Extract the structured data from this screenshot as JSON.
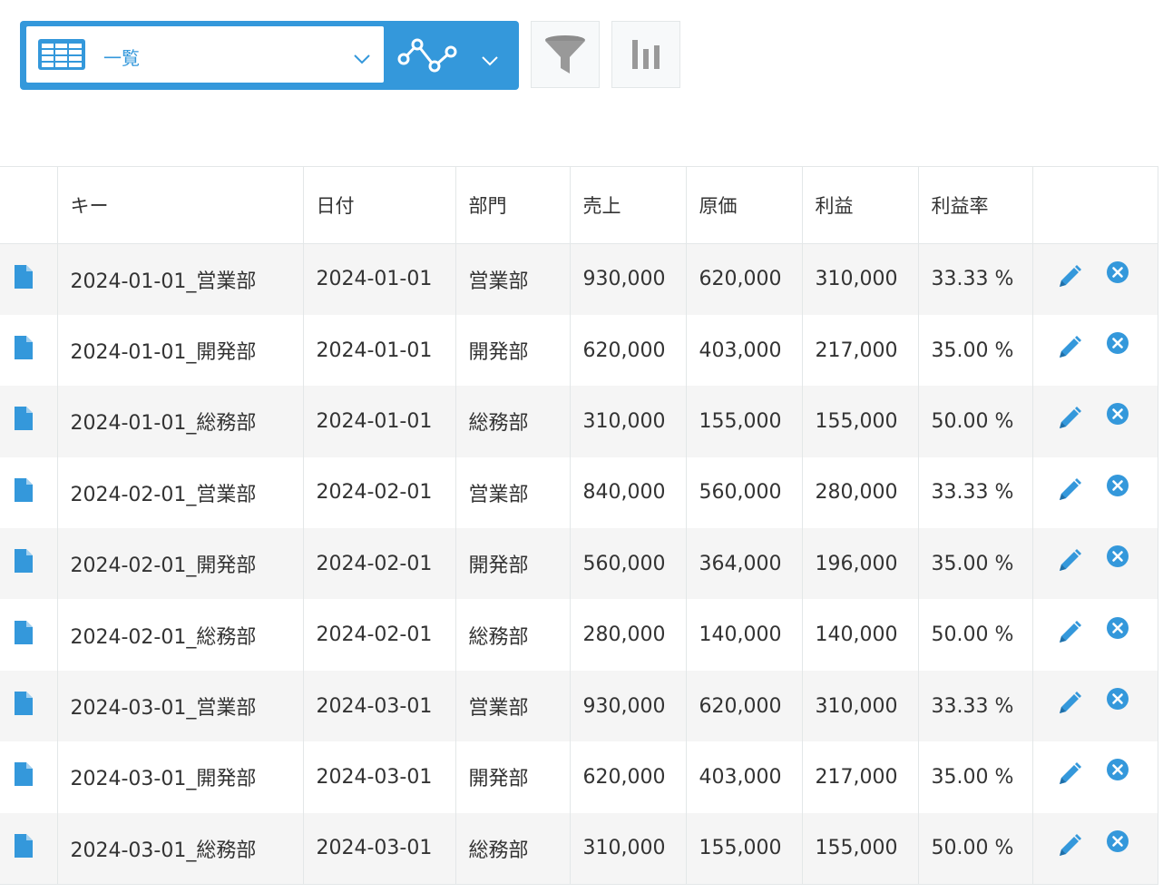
{
  "toolbar": {
    "view_label": "一覧",
    "icons": {
      "view": "table-list-icon",
      "graph": "line-graph-icon",
      "filter": "filter-funnel-icon",
      "report": "bar-chart-icon"
    }
  },
  "colors": {
    "accent": "#3498db",
    "row_alt": "#f5f5f5",
    "border": "#e3e7e8"
  },
  "table": {
    "headers": [
      "キー",
      "日付",
      "部門",
      "売上",
      "原価",
      "利益",
      "利益率"
    ],
    "rows": [
      {
        "key": "2024-01-01_営業部",
        "date": "2024-01-01",
        "dept": "営業部",
        "sales": "930,000",
        "cost": "620,000",
        "profit": "310,000",
        "rate": "33.33 %"
      },
      {
        "key": "2024-01-01_開発部",
        "date": "2024-01-01",
        "dept": "開発部",
        "sales": "620,000",
        "cost": "403,000",
        "profit": "217,000",
        "rate": "35.00 %"
      },
      {
        "key": "2024-01-01_総務部",
        "date": "2024-01-01",
        "dept": "総務部",
        "sales": "310,000",
        "cost": "155,000",
        "profit": "155,000",
        "rate": "50.00 %"
      },
      {
        "key": "2024-02-01_営業部",
        "date": "2024-02-01",
        "dept": "営業部",
        "sales": "840,000",
        "cost": "560,000",
        "profit": "280,000",
        "rate": "33.33 %"
      },
      {
        "key": "2024-02-01_開発部",
        "date": "2024-02-01",
        "dept": "開発部",
        "sales": "560,000",
        "cost": "364,000",
        "profit": "196,000",
        "rate": "35.00 %"
      },
      {
        "key": "2024-02-01_総務部",
        "date": "2024-02-01",
        "dept": "総務部",
        "sales": "280,000",
        "cost": "140,000",
        "profit": "140,000",
        "rate": "50.00 %"
      },
      {
        "key": "2024-03-01_営業部",
        "date": "2024-03-01",
        "dept": "営業部",
        "sales": "930,000",
        "cost": "620,000",
        "profit": "310,000",
        "rate": "33.33 %"
      },
      {
        "key": "2024-03-01_開発部",
        "date": "2024-03-01",
        "dept": "開発部",
        "sales": "620,000",
        "cost": "403,000",
        "profit": "217,000",
        "rate": "35.00 %"
      },
      {
        "key": "2024-03-01_総務部",
        "date": "2024-03-01",
        "dept": "総務部",
        "sales": "310,000",
        "cost": "155,000",
        "profit": "155,000",
        "rate": "50.00 %"
      }
    ]
  }
}
